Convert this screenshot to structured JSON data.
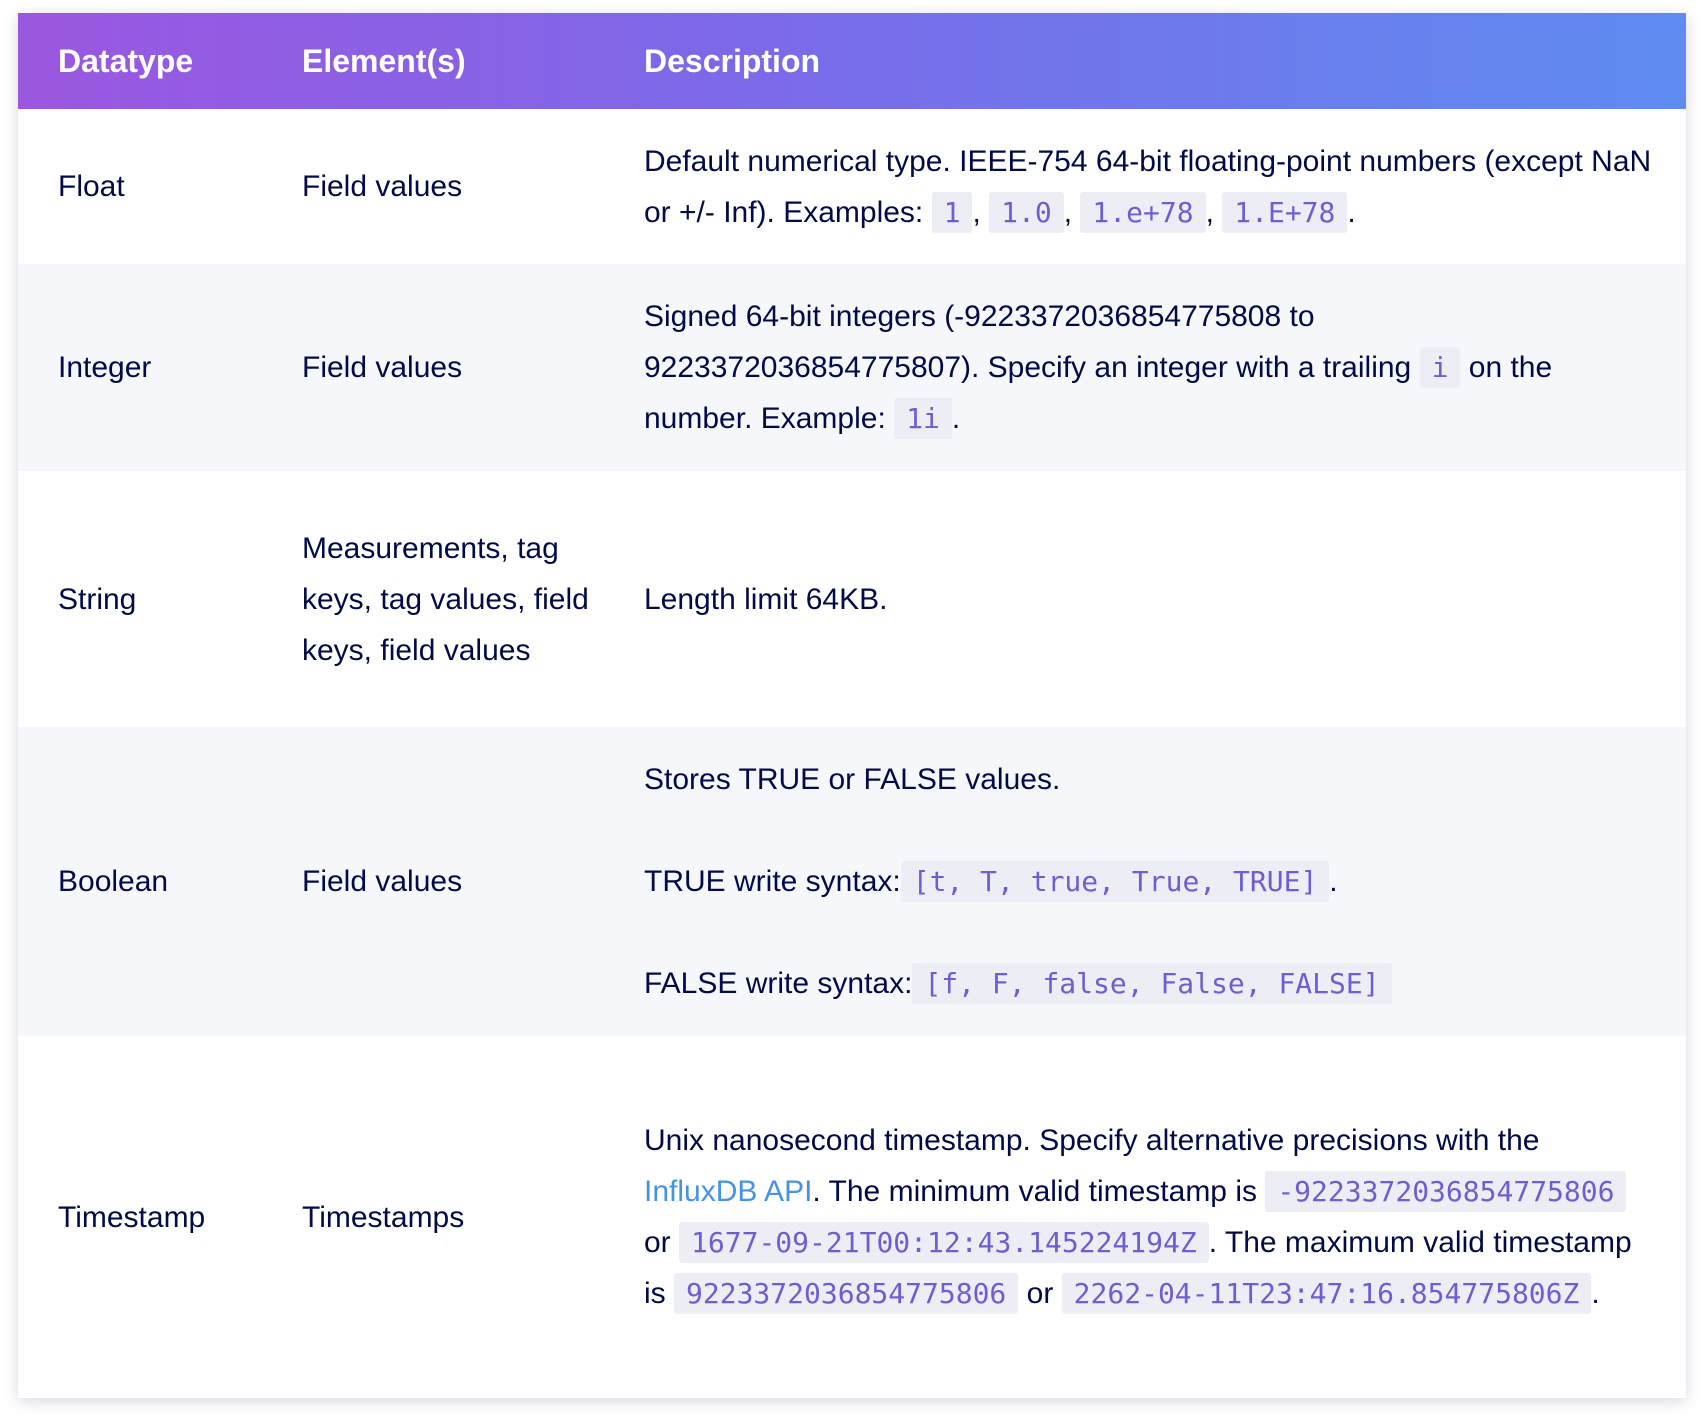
{
  "table": {
    "headers": {
      "datatype": "Datatype",
      "elements": "Element(s)",
      "description": "Description"
    },
    "rows": {
      "float": {
        "datatype": "Float",
        "elements": "Field values",
        "desc_text": "Default numerical type. IEEE-754 64-bit floating-point numbers (except NaN or +/- Inf). Examples: ",
        "examples": [
          "1",
          "1.0",
          "1.e+78",
          "1.E+78"
        ],
        "sep": ",",
        "end": "."
      },
      "integer": {
        "datatype": "Integer",
        "elements": "Field values",
        "desc_text_1": "Signed 64-bit integers (-9223372036854775808 to 9223372036854775807). Specify an integer with a trailing ",
        "suffix_code": "i",
        "desc_text_2": " on the number. Example: ",
        "example_code": "1i",
        "end": "."
      },
      "string": {
        "datatype": "String",
        "elements": "Measurements, tag keys, tag values, field keys, field values",
        "description": "Length limit 64KB."
      },
      "boolean": {
        "datatype": "Boolean",
        "elements": "Field values",
        "line_1": "Stores TRUE or FALSE values.",
        "true_label": "TRUE write syntax:",
        "true_code": "[t, T, true, True, TRUE]",
        "false_label": "FALSE write syntax:",
        "false_code": "[f, F, false, False, FALSE]",
        "end": "."
      },
      "timestamp": {
        "datatype": "Timestamp",
        "elements": "Timestamps",
        "text_1": "Unix nanosecond timestamp. Specify alternative precisions with the ",
        "link_label": "InfluxDB API",
        "text_2": ". The minimum valid timestamp is ",
        "min_ns": "-9223372036854775806",
        "or_1": " or ",
        "min_rfc": "1677-09-21T00:12:43.145224194Z",
        "text_3": ". The maximum valid timestamp is ",
        "max_ns": "9223372036854775806",
        "or_2": " or ",
        "max_rfc": "2262-04-11T23:47:16.854775806Z",
        "end": "."
      }
    }
  },
  "colors": {
    "header_gradient_start": "#9b57e0",
    "header_gradient_end": "#5e8cf0",
    "text": "#020a47",
    "code_text": "#6b5fd2",
    "code_bg": "#ecedf5",
    "link": "#4592e8",
    "row_alt_bg": "#f6f7fb"
  }
}
